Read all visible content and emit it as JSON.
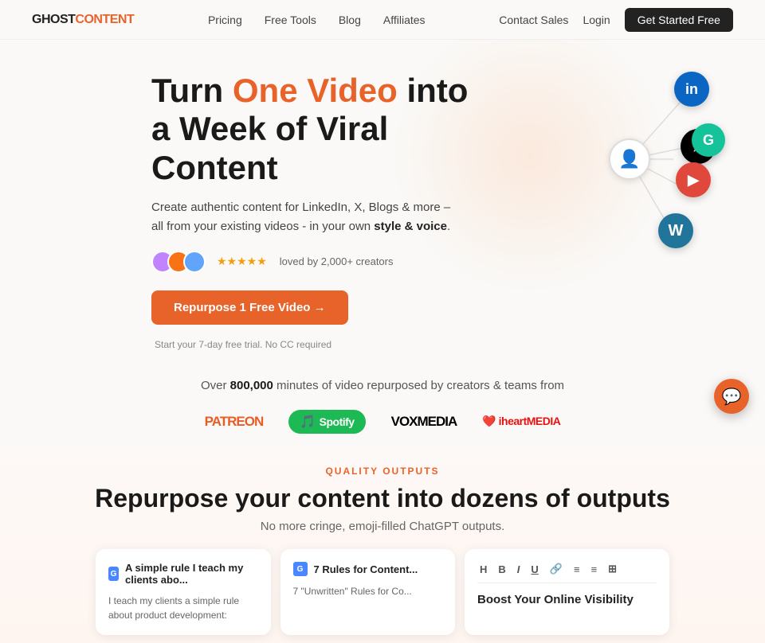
{
  "brand": {
    "name_ghost": "GHOST",
    "name_content": "CONTENT",
    "logo_full": "GHOSTCONTENT"
  },
  "navbar": {
    "links": [
      {
        "label": "Pricing",
        "id": "pricing"
      },
      {
        "label": "Free Tools",
        "id": "free-tools"
      },
      {
        "label": "Blog",
        "id": "blog"
      },
      {
        "label": "Affiliates",
        "id": "affiliates"
      }
    ],
    "right_links": [
      {
        "label": "Contact Sales",
        "id": "contact-sales"
      },
      {
        "label": "Login",
        "id": "login"
      }
    ],
    "cta_label": "Get Started Free"
  },
  "hero": {
    "title_part1": "Turn ",
    "title_highlight": "One Video",
    "title_part2": " into a Week of Viral Content",
    "description": "Create authentic content for LinkedIn, X, Blogs & more – all from your existing videos - in your own ",
    "description_bold": "style & voice",
    "description_end": ".",
    "social_proof_text": "loved by 2,000+ creators",
    "cta_label": "Repurpose 1 Free Video →",
    "trial_text": "Start your 7-day free trial. No CC required"
  },
  "network": {
    "nodes": [
      {
        "id": "linkedin",
        "label": "in"
      },
      {
        "id": "x",
        "label": "𝕏"
      },
      {
        "id": "grammarly",
        "label": "G"
      },
      {
        "id": "buffer",
        "label": "▶"
      },
      {
        "id": "wordpress",
        "label": "W"
      }
    ]
  },
  "stats": {
    "prefix": "Over ",
    "number": "800,000",
    "suffix": " minutes of video repurposed by creators & teams from"
  },
  "brands": [
    {
      "id": "patreon",
      "label": "PATREON"
    },
    {
      "id": "spotify",
      "label": "Spotify"
    },
    {
      "id": "voxmedia",
      "label": "VOXMEDIA"
    },
    {
      "id": "iheartmedia",
      "label": "iheartMEDIA"
    }
  ],
  "quality": {
    "label": "QUALITY OUTPUTS",
    "title": "Repurpose your content into dozens of outputs",
    "description": "No more cringe, emoji-filled ChatGPT outputs."
  },
  "cards": [
    {
      "id": "card-1",
      "icon": "doc",
      "title": "A simple rule I teach my clients abo...",
      "body": "I teach my clients a simple rule about product development:"
    },
    {
      "id": "card-2",
      "icon": "doc",
      "title": "7 Rules for Content...",
      "body": "7 \"Unwritten\" Rules for Co..."
    }
  ],
  "editor_card": {
    "toolbar": [
      "H",
      "B",
      "I",
      "U",
      "🔗",
      "≡",
      "≡",
      "⊞"
    ],
    "title": "Boost Your Online Visibility"
  },
  "chat": {
    "icon": "💬"
  }
}
